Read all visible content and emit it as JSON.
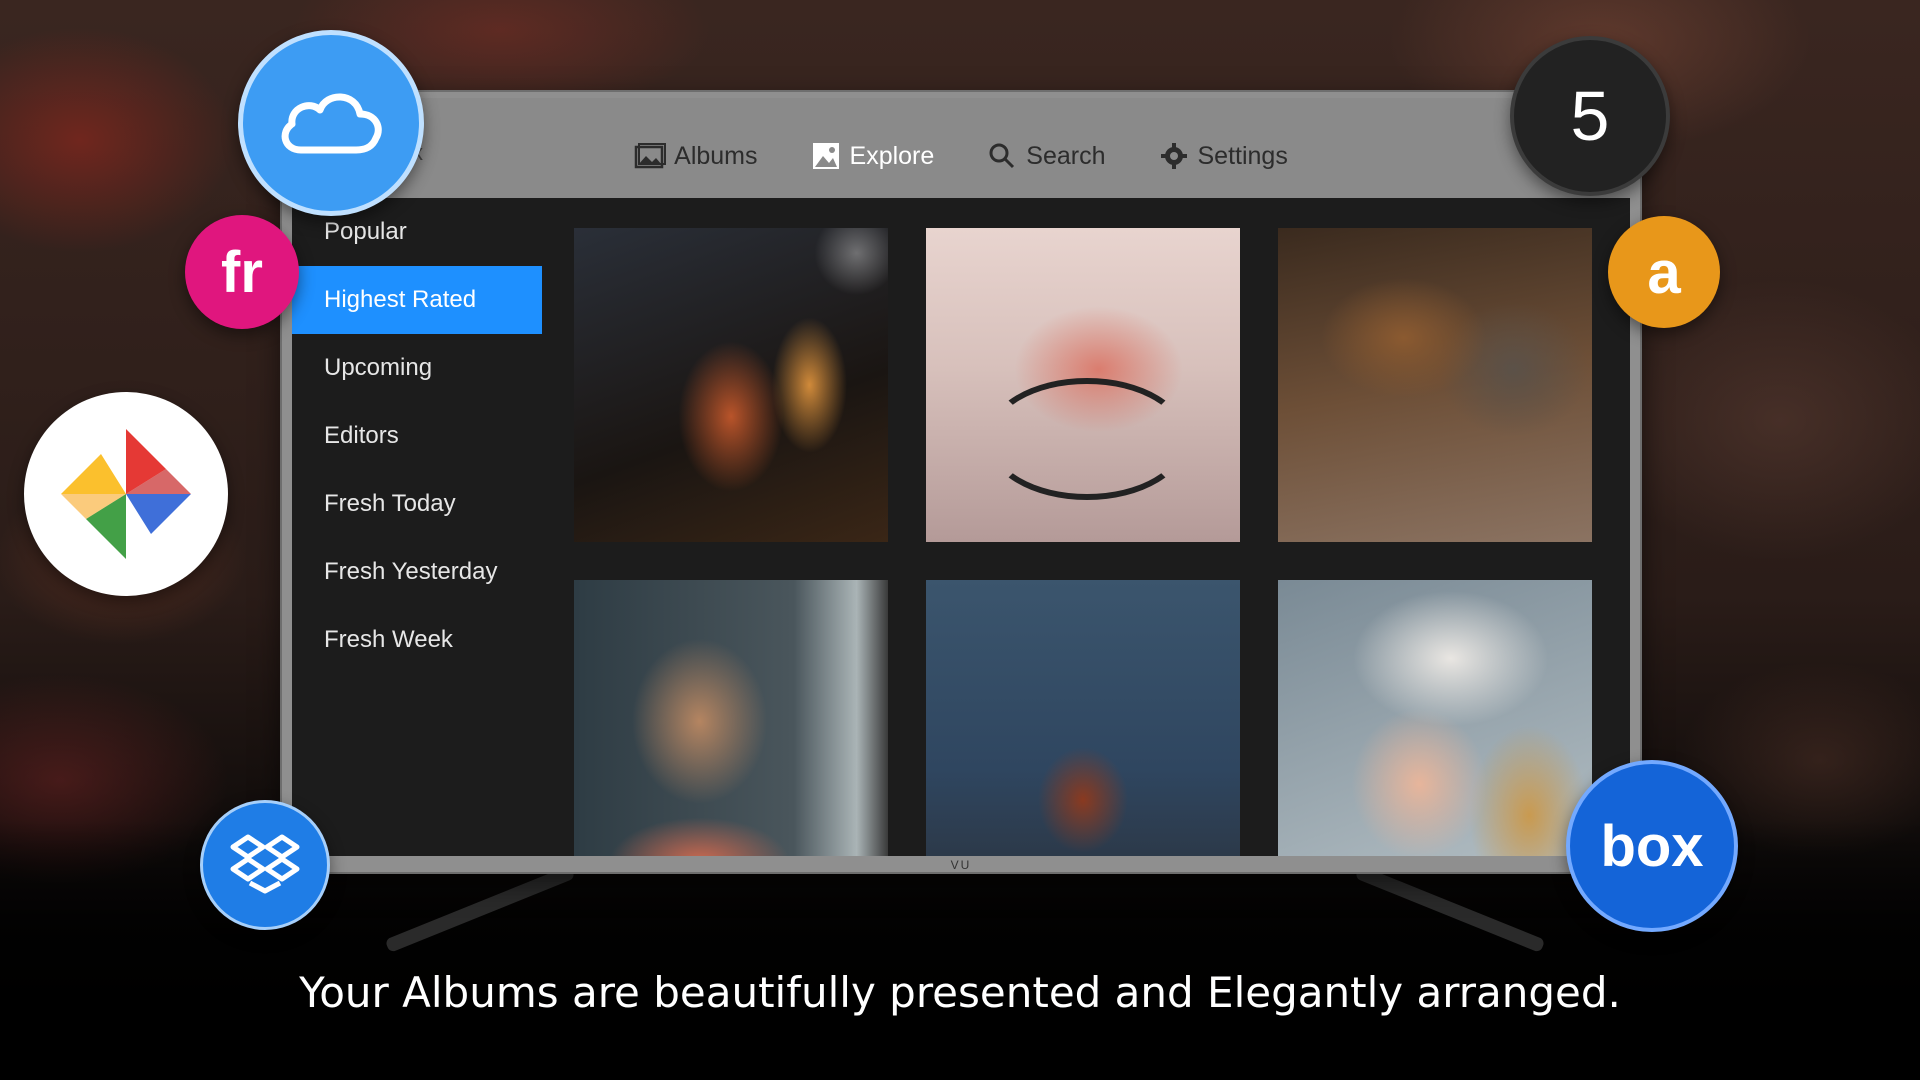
{
  "app": {
    "name": "x"
  },
  "nav": {
    "items": [
      {
        "label": "Albums",
        "icon": "albums-icon",
        "active": false
      },
      {
        "label": "Explore",
        "icon": "explore-icon",
        "active": true
      },
      {
        "label": "Search",
        "icon": "search-icon",
        "active": false
      },
      {
        "label": "Settings",
        "icon": "gear-icon",
        "active": false
      }
    ]
  },
  "sidebar": {
    "items": [
      {
        "label": "Popular"
      },
      {
        "label": "Highest Rated",
        "selected": true
      },
      {
        "label": "Upcoming"
      },
      {
        "label": "Editors"
      },
      {
        "label": "Fresh Today"
      },
      {
        "label": "Fresh Yesterday"
      },
      {
        "label": "Fresh Week"
      }
    ]
  },
  "photos": [
    {
      "subject": "drinks-photo"
    },
    {
      "subject": "bicycle-photo"
    },
    {
      "subject": "dog-and-cat-photo"
    },
    {
      "subject": "girl-photo"
    },
    {
      "subject": "camera-photo"
    },
    {
      "subject": "snow-girl-photo"
    }
  ],
  "tv": {
    "brand": "VU"
  },
  "services": {
    "cloud": {
      "icon": "cloud-icon",
      "color": "#3d9cf3"
    },
    "flickr": {
      "label": "fr",
      "color": "#e0167e"
    },
    "google_photos": {
      "icon": "pinwheel-icon"
    },
    "dropbox": {
      "icon": "dropbox-icon",
      "color": "#1f7de6"
    },
    "fivehundredpx": {
      "label": "5",
      "color": "#222222"
    },
    "amazon": {
      "label": "a",
      "color": "#e8971a"
    },
    "box": {
      "label": "box",
      "color": "#1464d8"
    }
  },
  "colors": {
    "accent": "#1e90ff"
  },
  "tagline": "Your Albums are beautifully presented and Elegantly arranged."
}
